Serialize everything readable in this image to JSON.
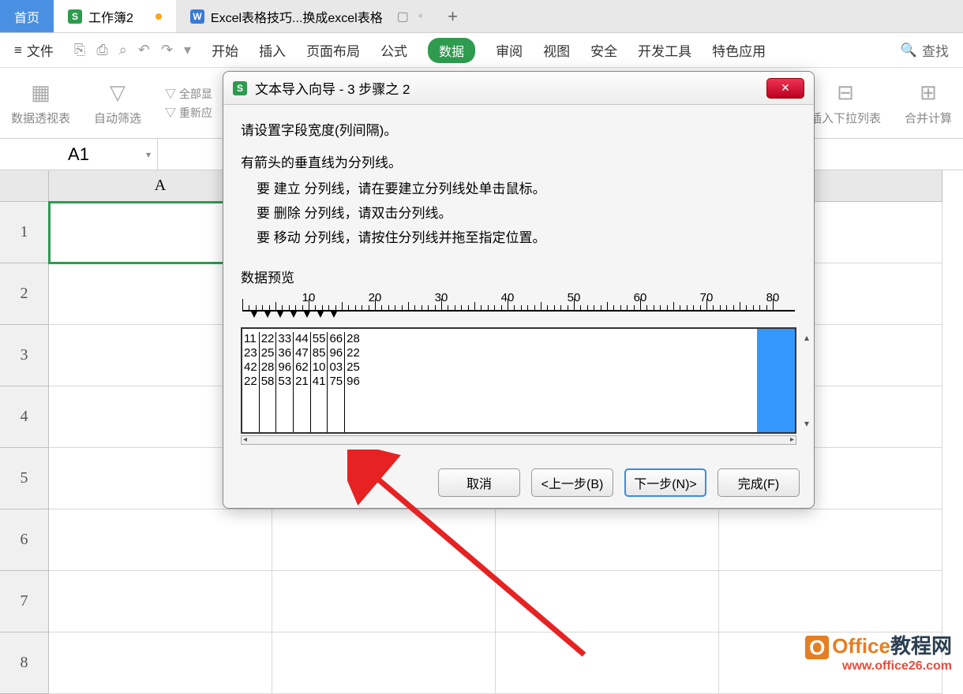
{
  "tabs": {
    "home": "首页",
    "workbook": "工作簿2",
    "excel_tab": "Excel表格技巧...换成excel表格"
  },
  "menu": {
    "file": "文件",
    "start": "开始",
    "insert": "插入",
    "page_layout": "页面布局",
    "formula": "公式",
    "data": "数据",
    "review": "审阅",
    "view": "视图",
    "security": "安全",
    "dev_tools": "开发工具",
    "special": "特色应用",
    "search": "查找"
  },
  "ribbon": {
    "pivot": "数据透视表",
    "autofilter": "自动筛选",
    "all_show": "全部显",
    "reapply": "重新应",
    "insert_dropdown": "插入下拉列表",
    "merge_calc": "合并计算"
  },
  "namebox": "A1",
  "columns": [
    "A"
  ],
  "rows": [
    "1",
    "2",
    "3",
    "4",
    "5",
    "6",
    "7",
    "8"
  ],
  "dialog": {
    "title": "文本导入向导 - 3 步骤之 2",
    "line1": "请设置字段宽度(列间隔)。",
    "line2": "有箭头的垂直线为分列线。",
    "sub1": "要 建立 分列线，请在要建立分列线处单击鼠标。",
    "sub2": "要 删除 分列线，请双击分列线。",
    "sub3": "要 移动 分列线，请按住分列线并拖至指定位置。",
    "preview_label": "数据预览",
    "ruler_marks": [
      "10",
      "20",
      "30",
      "40",
      "50",
      "60",
      "70",
      "80"
    ],
    "preview_rows": [
      [
        "11",
        "22",
        "33",
        "44",
        "55",
        "66",
        "28"
      ],
      [
        "23",
        "25",
        "36",
        "47",
        "85",
        "96",
        "22"
      ],
      [
        "42",
        "28",
        "96",
        "62",
        "10",
        "03",
        "25"
      ],
      [
        "22",
        "58",
        "53",
        "21",
        "41",
        "75",
        "96"
      ]
    ],
    "btn_cancel": "取消",
    "btn_back": "<上一步(B)",
    "btn_next": "下一步(N)>",
    "btn_finish": "完成(F)"
  },
  "watermark": {
    "line1a": "Office",
    "line1b": "教程网",
    "line2": "www.office26.com"
  }
}
